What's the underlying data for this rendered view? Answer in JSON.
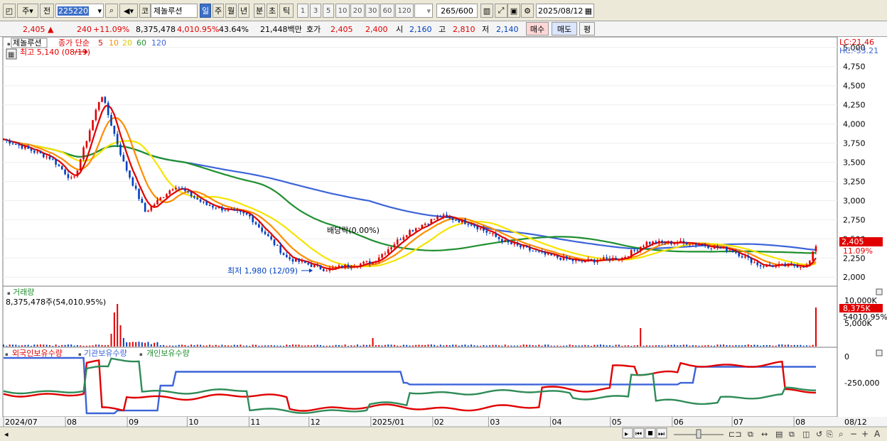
{
  "toolbar": {
    "market_label": "주",
    "prev_label": "전",
    "code_value": "225220",
    "prefix_label": "코",
    "stock_name": "제놀루션",
    "periods": [
      "일",
      "주",
      "월",
      "년",
      "분",
      "초",
      "틱"
    ],
    "intervals": [
      "1",
      "3",
      "5",
      "10",
      "20",
      "30",
      "60",
      "120"
    ],
    "count_value": "265",
    "count_total": "/600",
    "date_value": "2025/08/12"
  },
  "quote": {
    "price": "2,405",
    "change": "240",
    "change_pct": "+11.09%",
    "volume": "8,375,478",
    "volume_pct": "4,010.95%",
    "turnover_rate": "43.64%",
    "amount": "21,448백만",
    "bid_label": "호가",
    "bid": "2,405",
    "ask": "2,400",
    "open_label": "시",
    "open": "2,160",
    "high_label": "고",
    "high": "2,810",
    "low_label": "저",
    "low": "2,140",
    "buy_label": "매수",
    "sell_label": "매도",
    "eval_label": "평"
  },
  "colors": {
    "up": "#e00000",
    "down": "#0040c0",
    "ma5": "#e00000",
    "ma10": "#ff8c00",
    "ma20": "#f5e400",
    "ma60": "#1f8f2f",
    "ma120": "#3c64d8",
    "foreign": "#e00000",
    "institution": "#3c64d8",
    "individual": "#2e8b57"
  },
  "chart_data": [
    {
      "type": "candlestick",
      "title": "제놀루션",
      "legend": [
        "종가 단순",
        "5",
        "10",
        "20",
        "60",
        "120"
      ],
      "ylim": [
        1900,
        5100
      ],
      "y_ticks": [
        "2,000",
        "2,250",
        "2,500",
        "2,750",
        "3,000",
        "3,250",
        "3,500",
        "3,750",
        "4,000",
        "4,250",
        "4,500",
        "4,750",
        "5,000"
      ],
      "x_ticks": [
        "2024/07",
        "08",
        "09",
        "10",
        "11",
        "12",
        "2025/01",
        "02",
        "03",
        "04",
        "05",
        "06",
        "07",
        "08",
        "08/12"
      ],
      "top_right": [
        "LC:21.46",
        "HC:-53.21"
      ],
      "last_price_label": "2,405",
      "last_change_label": "11.09%",
      "annotations": {
        "high": "최고 5,140 (08/19)",
        "low": "최저 1,980 (12/09)",
        "dividend": "배당락(0.00%)"
      },
      "approx_close_path": [
        {
          "date": "2024-07-01",
          "close": 3800
        },
        {
          "date": "2024-07-25",
          "close": 3550
        },
        {
          "date": "2024-08-05",
          "close": 3250
        },
        {
          "date": "2024-08-19",
          "close": 4400
        },
        {
          "date": "2024-08-30",
          "close": 3500
        },
        {
          "date": "2024-09-10",
          "close": 2850
        },
        {
          "date": "2024-09-25",
          "close": 3200
        },
        {
          "date": "2024-10-10",
          "close": 2950
        },
        {
          "date": "2024-11-01",
          "close": 2800
        },
        {
          "date": "2024-11-20",
          "close": 2250
        },
        {
          "date": "2024-12-09",
          "close": 2100
        },
        {
          "date": "2025-01-02",
          "close": 2200
        },
        {
          "date": "2025-01-20",
          "close": 2600
        },
        {
          "date": "2025-02-05",
          "close": 2800
        },
        {
          "date": "2025-02-20",
          "close": 2700
        },
        {
          "date": "2025-03-10",
          "close": 2450
        },
        {
          "date": "2025-03-28",
          "close": 2300
        },
        {
          "date": "2025-04-15",
          "close": 2200
        },
        {
          "date": "2025-05-07",
          "close": 2250
        },
        {
          "date": "2025-05-19",
          "close": 2450
        },
        {
          "date": "2025-06-10",
          "close": 2450
        },
        {
          "date": "2025-07-01",
          "close": 2350
        },
        {
          "date": "2025-07-15",
          "close": 2150
        },
        {
          "date": "2025-08-08",
          "close": 2150
        },
        {
          "date": "2025-08-12",
          "close": 2405
        }
      ]
    },
    {
      "type": "bar",
      "title": "거래량",
      "readout": "8,375,478주(54,010.95%)",
      "y_ticks": [
        "10,000K",
        "5,000K"
      ],
      "last_value_label": "8,375K",
      "last_pct_label": "54010.95%"
    },
    {
      "type": "line",
      "series": [
        {
          "name": "외국인보유수량"
        },
        {
          "name": "기관보유수량"
        },
        {
          "name": "개인보유수량"
        }
      ],
      "y_ticks": [
        "0",
        "-250,000"
      ]
    }
  ]
}
